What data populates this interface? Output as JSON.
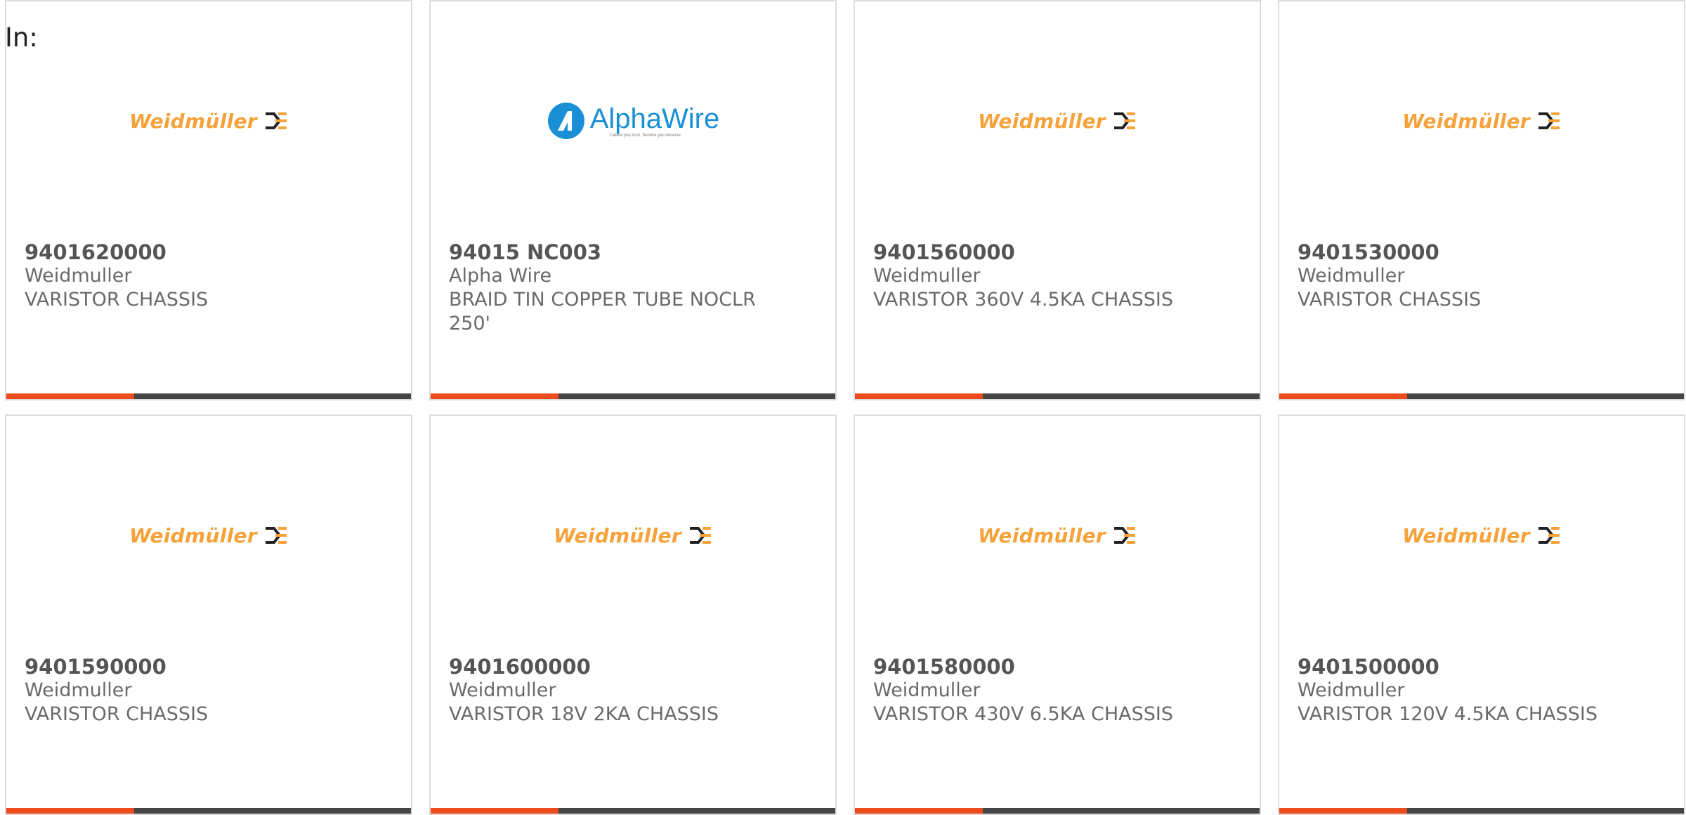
{
  "header": {
    "in_label": "In:"
  },
  "colors": {
    "accent": "#ef4a1d",
    "bar": "#454545",
    "weidmuller_orange": "#f5a23a",
    "alphawire_blue": "#1a8fd6"
  },
  "products": [
    {
      "part_number": "9401620000",
      "manufacturer": "Weidmuller",
      "description": "VARISTOR CHASSIS",
      "logo": "weidmuller-logo",
      "logo_text": "Weidmüller"
    },
    {
      "part_number": "94015 NC003",
      "manufacturer": "Alpha Wire",
      "description": "BRAID TIN COPPER TUBE NOCLR 250'",
      "logo": "alphawire-logo",
      "logo_text": "AlphaWire",
      "logo_tagline": "Cables you trust. Service you deserve."
    },
    {
      "part_number": "9401560000",
      "manufacturer": "Weidmuller",
      "description": "VARISTOR 360V 4.5KA CHASSIS",
      "logo": "weidmuller-logo",
      "logo_text": "Weidmüller"
    },
    {
      "part_number": "9401530000",
      "manufacturer": "Weidmuller",
      "description": "VARISTOR CHASSIS",
      "logo": "weidmuller-logo",
      "logo_text": "Weidmüller"
    },
    {
      "part_number": "9401590000",
      "manufacturer": "Weidmuller",
      "description": "VARISTOR CHASSIS",
      "logo": "weidmuller-logo",
      "logo_text": "Weidmüller"
    },
    {
      "part_number": "9401600000",
      "manufacturer": "Weidmuller",
      "description": "VARISTOR 18V 2KA CHASSIS",
      "logo": "weidmuller-logo",
      "logo_text": "Weidmüller"
    },
    {
      "part_number": "9401580000",
      "manufacturer": "Weidmuller",
      "description": "VARISTOR 430V 6.5KA CHASSIS",
      "logo": "weidmuller-logo",
      "logo_text": "Weidmüller"
    },
    {
      "part_number": "9401500000",
      "manufacturer": "Weidmuller",
      "description": "VARISTOR 120V 4.5KA CHASSIS",
      "logo": "weidmuller-logo",
      "logo_text": "Weidmüller"
    }
  ]
}
